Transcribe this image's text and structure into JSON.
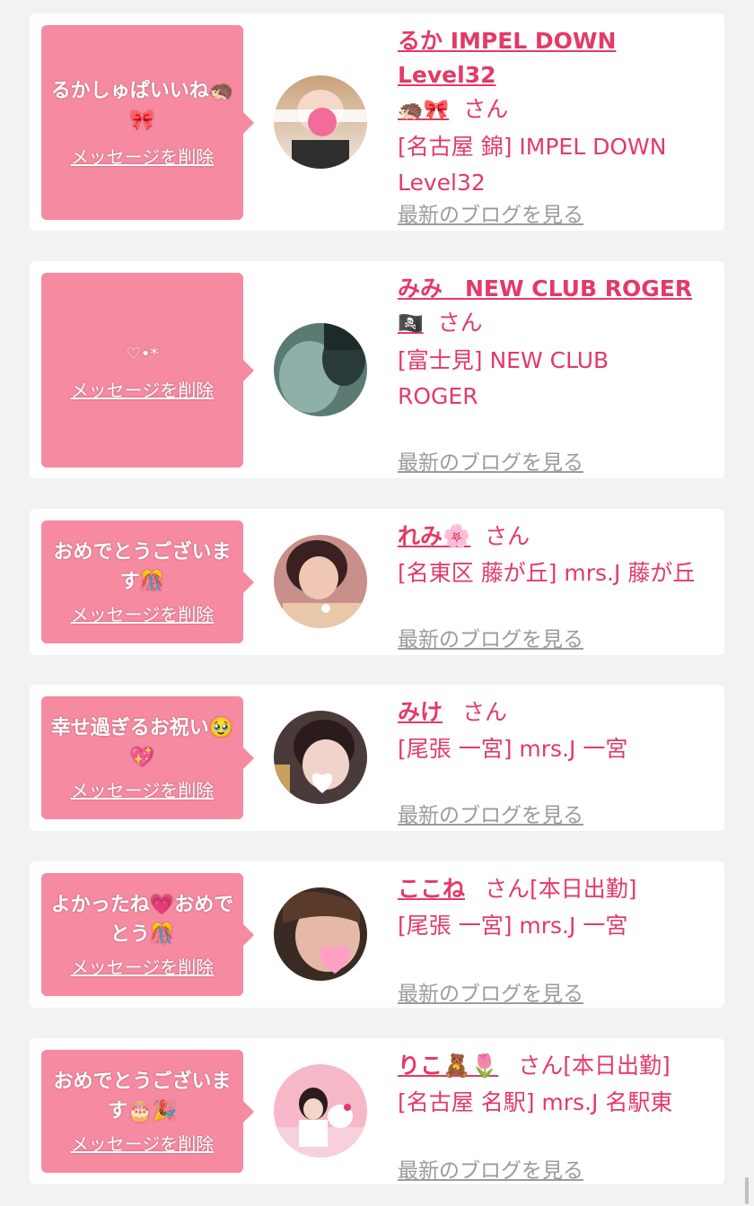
{
  "delete_label": "メッセージを削除",
  "blog_label": "最新のブログを見る",
  "san": "さん",
  "cards": [
    {
      "message": "るかしゅぱいいね🦔🎀",
      "name": "るか IMPEL DOWN Level32",
      "name_emoji": "🦔🎀",
      "status": "",
      "shop": "[名古屋 錦] IMPEL DOWN Level32",
      "avatar_icon": "avatar-photo-icon"
    },
    {
      "message": "♡•*",
      "name": "みみ　NEW CLUB ROGER",
      "name_emoji": "🏴‍☠️",
      "status": "",
      "shop": "[富士見] NEW CLUB ROGER",
      "avatar_icon": "avatar-photo-icon"
    },
    {
      "message": "おめでとうございます🎊",
      "name": "れみ🌸",
      "name_emoji": "",
      "status": "",
      "shop": "[名東区 藤が丘] mrs.J 藤が丘",
      "avatar_icon": "avatar-photo-icon"
    },
    {
      "message": "幸せ過ぎるお祝い🥹💖",
      "name": "みけ",
      "name_emoji": "",
      "status": "",
      "shop": "[尾張 一宮] mrs.J 一宮",
      "avatar_icon": "avatar-photo-icon"
    },
    {
      "message": "よかったね💗おめでとう🎊",
      "name": "ここね",
      "name_emoji": "",
      "status": "[本日出勤]",
      "shop": "[尾張 一宮] mrs.J 一宮",
      "avatar_icon": "avatar-photo-icon"
    },
    {
      "message": "おめでとうございます🎂🎉",
      "name": "りこ🧸🌷",
      "name_emoji": "",
      "status": "[本日出勤]",
      "shop": "[名古屋 名駅] mrs.J 名駅東",
      "avatar_icon": "avatar-photo-icon"
    }
  ],
  "colors": {
    "accent": "#e33a68",
    "bubble": "#f68aa0",
    "link_gray": "#9b9b9b",
    "background": "#f2f2f2"
  }
}
